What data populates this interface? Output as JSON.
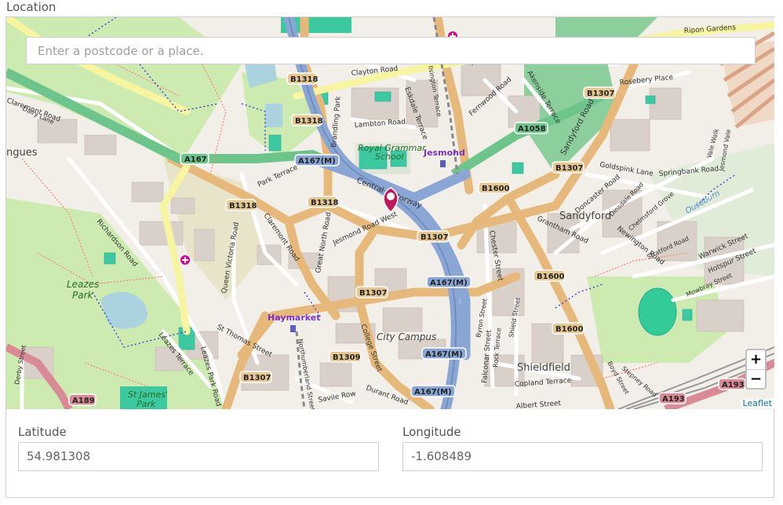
{
  "form": {
    "legend": "Location",
    "search_placeholder": "Enter a postcode or a place.",
    "latitude_label": "Latitude",
    "latitude_value": "54.981308",
    "longitude_label": "Longitude",
    "longitude_value": "-1.608489"
  },
  "map": {
    "zoom_in": "+",
    "zoom_out": "−",
    "attribution": "Leaflet",
    "marker_color": "#c2185b",
    "places": {
      "jesmond": "Jesmond",
      "haymarket": "Haymarket",
      "sandyford": "Sandyford",
      "shieldfield": "Shieldfield",
      "city_campus": "City Campus",
      "leazes_park_1": "Leazes",
      "leazes_park_2": "Park",
      "st_james_park_1": "St James'",
      "st_james_park_2": "Park",
      "royal_grammar_1": "Royal Grammar",
      "royal_grammar_2": "School",
      "ouseburn": "Ouseburn",
      "edge_left": "ngues"
    },
    "streets": {
      "clayton_road": "Clayton Road",
      "claremont_road_w": "Claremont Road",
      "claremont_road": "Claremont Road",
      "richardson_road": "Richardson Road",
      "queen_victoria_road": "Queen Victoria Road",
      "great_north_road": "Great North Road",
      "jesmond_road_west": "Jesmond Road West",
      "central_motorway": "Central Motorway",
      "st_thomas_street": "St Thomas Street",
      "college_street": "College Street",
      "durant_road": "Durant Road",
      "sandyford_road": "Sandyford Road",
      "goldspink_lane": "Goldspink Lane",
      "springbank_road": "Springbank Road",
      "chester_street": "Chester Street",
      "lambton_road": "Lambton Road",
      "park_terrace": "Park Terrace",
      "eskdale_terrace": "Eskdale Terrace",
      "brandling_park": "Brandling Park",
      "fernwood_road": "Fernwood Road",
      "akenside_terrace": "Akenside Terrace",
      "rosebery_place": "Rosebery Place",
      "ripon_gardens": "Ripon Gardens",
      "doncaster_road": "Doncaster Road",
      "grantham_road": "Grantham Road",
      "newington_road": "Newington Road",
      "warwick_street": "Warwick Street",
      "hotspur_street": "Hotspur Street",
      "copland_terrace": "Copland Terrace",
      "falconar_street": "Falconar Street",
      "albert_street": "Albert Street",
      "savile_row": "Savile Row",
      "leazes_terrace": "Leazes Terrace",
      "leazes_park_road": "Leazes Park Road",
      "northumberland_street": "Northumberland Street",
      "derby_street": "Derby Street",
      "dairy_lane": "Dairy Lane",
      "byron_street": "Byron Street",
      "rock_terrace": "Rock Terrace",
      "shield_street": "Shield Street",
      "stratford_road": "Stratford Road",
      "chelmsford_grove": "Chelmsford Grove",
      "dinsdale_road": "Dinsdale Road",
      "mowbray_street": "Mowbray Street",
      "boyd_street": "Boyd Street",
      "stepney_road": "Stepney Road",
      "vale_walk": "Vale Walk",
      "jesmond_vale": "Jesmond Vale",
      "ilsington_terrace": "Ilsington Terrace",
      "clayton_road_e": "Clayton Road"
    },
    "shields": {
      "b1318_a": "B1318",
      "b1318_b": "B1318",
      "b1318_c": "B1318",
      "b1318_d": "B1318",
      "a167m_a": "A167(M)",
      "a167m_b": "A167(M)",
      "a167m_c": "A167(M)",
      "a167m_d": "A167(M)",
      "a167": "A167",
      "b1307_a": "B1307",
      "b1307_b": "B1307",
      "b1307_c": "B1307",
      "b1307_d": "B1307",
      "b1307_e": "B1307",
      "a1058": "A1058",
      "b1600_a": "B1600",
      "b1600_b": "B1600",
      "b1600_c": "B1600",
      "b1309": "B1309",
      "a189": "A189",
      "a193_a": "A193",
      "a193_b": "A193"
    }
  }
}
